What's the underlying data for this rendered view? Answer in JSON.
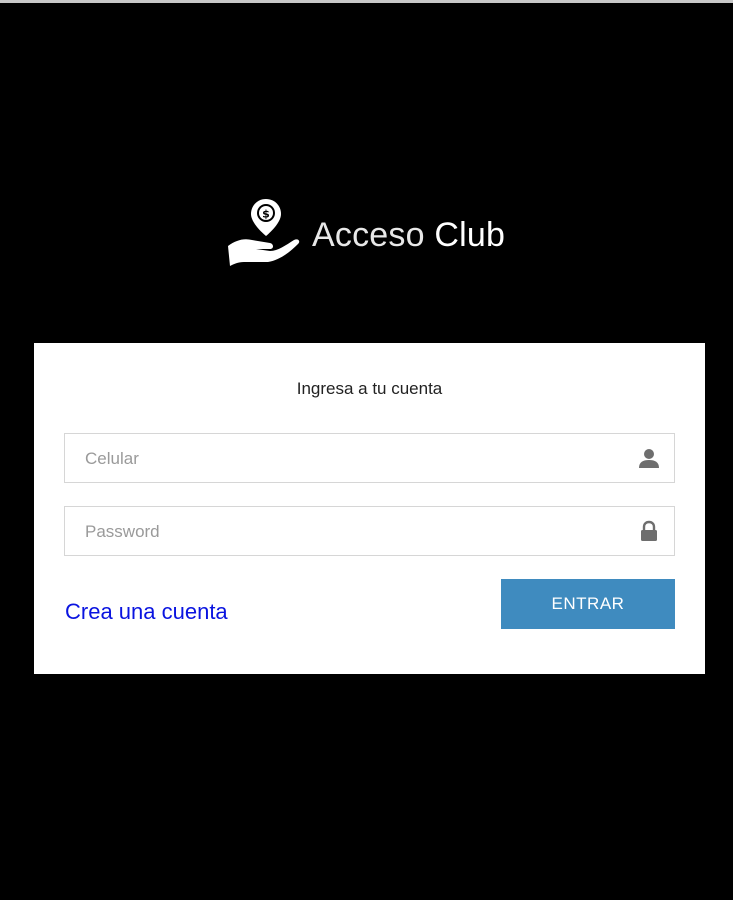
{
  "brand": {
    "name_part1": "Acceso",
    "name_part2": "Club",
    "logo_icon": "hand-money-pin-icon"
  },
  "login": {
    "title": "Ingresa a tu cuenta",
    "phone": {
      "placeholder": "Celular",
      "value": "",
      "icon": "user-icon"
    },
    "password": {
      "placeholder": "Password",
      "value": "",
      "icon": "lock-icon"
    },
    "create_account_label": "Crea una cuenta",
    "submit_label": "ENTRAR"
  },
  "colors": {
    "background": "#000000",
    "card": "#ffffff",
    "link": "#0a14e0",
    "button": "#3f8bbf",
    "icon": "#6e6e6e"
  }
}
